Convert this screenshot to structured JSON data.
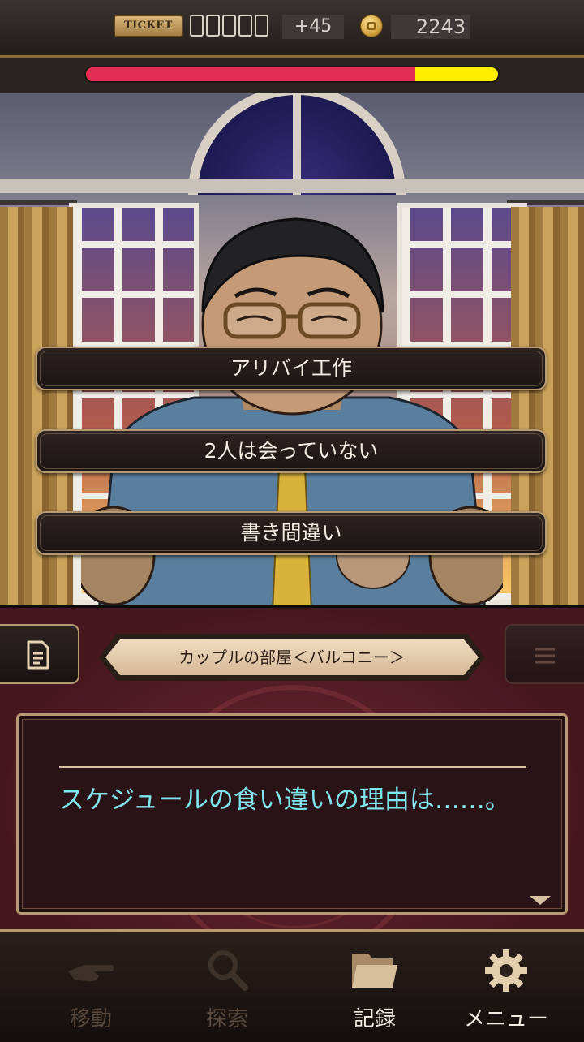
{
  "hud": {
    "ticket_label": "TICKET",
    "ticket_slots": 5,
    "ticket_count": "+45",
    "coin_icon": "coin-icon",
    "coins": "2243",
    "health_fraction": 0.8,
    "health_color": "#e22d55",
    "health_remaining_color": "#ffee00"
  },
  "choices": [
    {
      "label": "アリバイ工作"
    },
    {
      "label": "2人は会っていない"
    },
    {
      "label": "書き間違い"
    }
  ],
  "panel": {
    "location": "カップルの部屋＜バルコニー＞",
    "notes_icon": "document-icon",
    "list_icon": "list-icon"
  },
  "dialog": {
    "text": "スケジュールの食い違いの理由は……。",
    "text_color": "#7fe6ee",
    "next_icon": "triangle-down-icon"
  },
  "nav": {
    "items": [
      {
        "label": "移動",
        "icon": "hand-pointing-icon",
        "enabled": false
      },
      {
        "label": "探索",
        "icon": "magnifier-icon",
        "enabled": false
      },
      {
        "label": "記録",
        "icon": "folder-icon",
        "enabled": true
      },
      {
        "label": "メニュー",
        "icon": "gear-icon",
        "enabled": true
      }
    ]
  }
}
